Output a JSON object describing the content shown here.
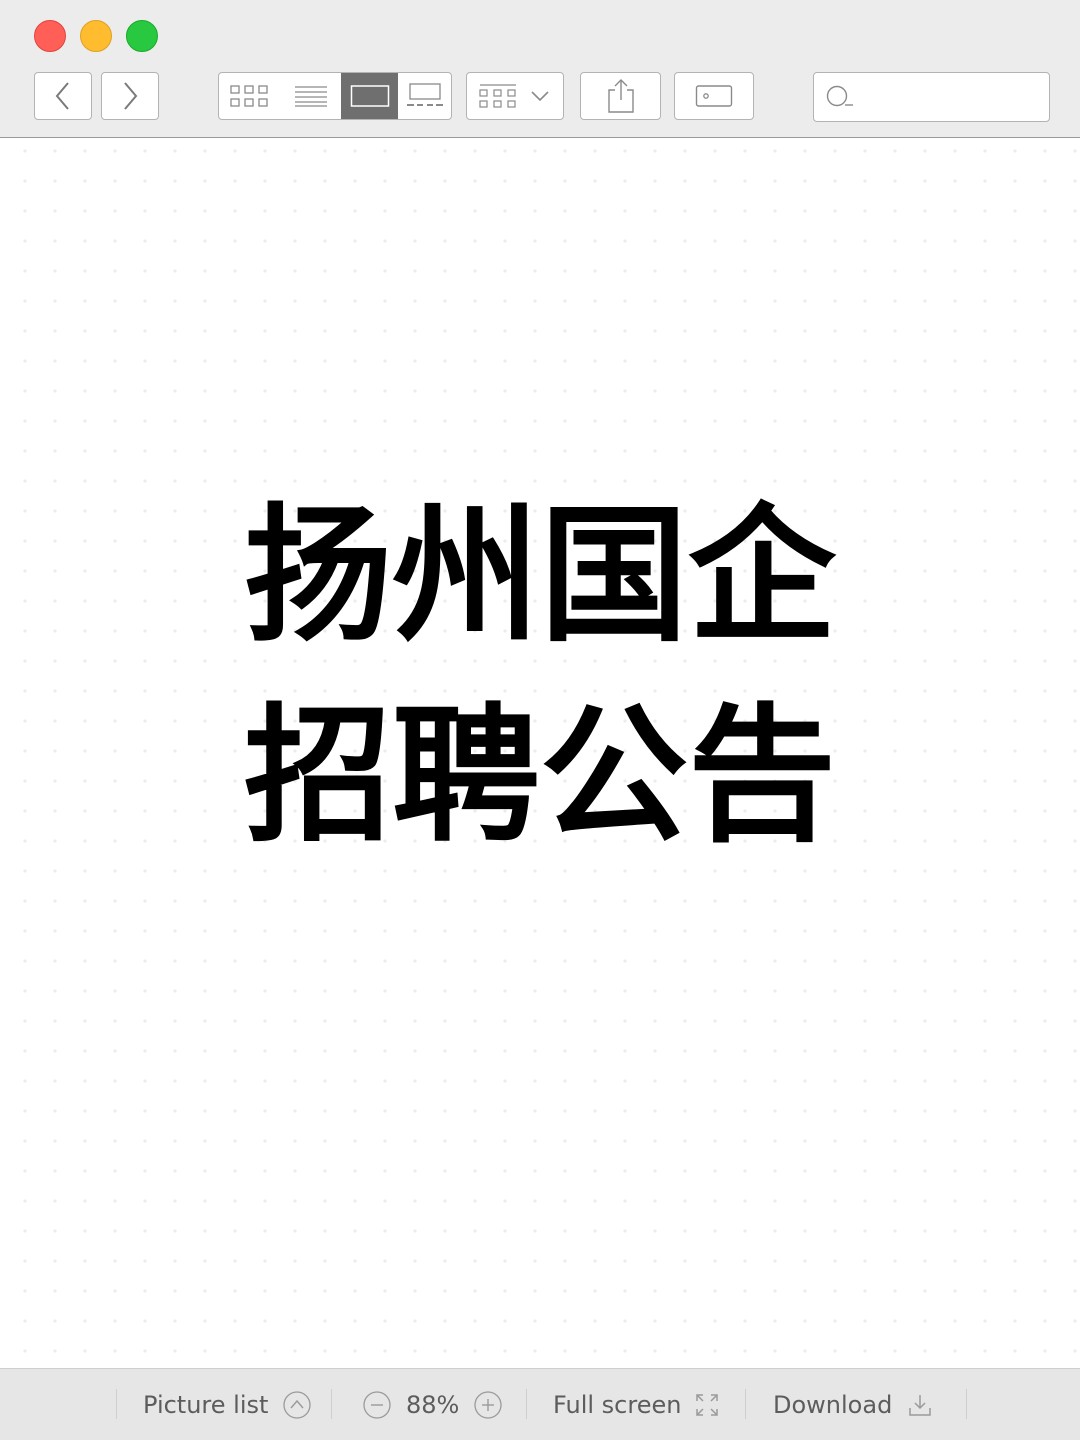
{
  "toolbar": {
    "search": {
      "value": "",
      "placeholder": ""
    },
    "icons": {
      "back": "chevron-left-icon",
      "forward": "chevron-right-icon",
      "grid_view": "grid-view-icon",
      "list_view": "list-view-icon",
      "single_view": "single-page-view-icon",
      "filmstrip_view": "filmstrip-view-icon",
      "arrange": "arrange-grid-icon",
      "share": "share-icon",
      "tag": "tag-icon",
      "search": "search-icon"
    },
    "selected_view": "single-page"
  },
  "content": {
    "headline_line1": "扬州国企",
    "headline_line2": "招聘公告"
  },
  "bottombar": {
    "picture_list_label": "Picture list",
    "zoom_value": "88%",
    "fullscreen_label": "Full screen",
    "download_label": "Download"
  },
  "colors": {
    "close": "#ff5f57",
    "minimize": "#febc2e",
    "zoom": "#28c840",
    "toolbar_bg": "#ececec",
    "selected_segment": "#6f6f6f",
    "bottombar_bg": "#e6e6e6",
    "text": "#000000"
  }
}
